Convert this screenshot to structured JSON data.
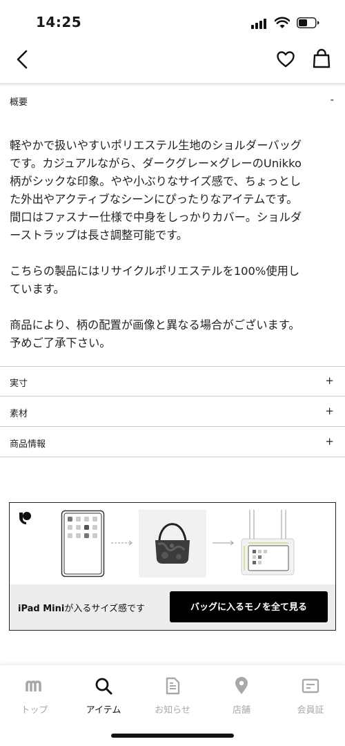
{
  "status_bar": {
    "time": "14:25",
    "signal_icon": "signal-bars-icon",
    "wifi_icon": "wifi-icon",
    "battery_icon": "battery-icon"
  },
  "nav": {
    "back_icon": "chevron-left-icon",
    "favorite_icon": "heart-icon",
    "cart_icon": "shopping-bag-icon"
  },
  "accordion": {
    "summary": {
      "label": "概要",
      "toggle": "-",
      "paragraphs": [
        "軽やかで扱いやすいポリエステル生地のショルダーバッグ\nです。カジュアルながら、ダークグレー×グレーのUnikko\n柄がシックな印象。やや小ぶりなサイズ感で、ちょっとし\nた外出やアクティブなシーンにぴったりなアイテムです。\n間口はファスナー仕様で中身をしっかりカバー。ショルダ\nーストラップは長さ調整可能です。",
        "こちらの製品にはリサイクルポリエステルを100%使用し\nています。",
        "商品により、柄の配置が画像と異なる場合がございます。\n予めご了承下さい。"
      ]
    },
    "sections": [
      {
        "label": "実寸",
        "toggle": "+"
      },
      {
        "label": "素材",
        "toggle": "+"
      },
      {
        "label": "商品情報",
        "toggle": "+"
      }
    ]
  },
  "size_banner": {
    "logo_icon": "unikko-logo-icon",
    "caption_bold": "iPad Mini",
    "caption_rest": "が入るサイズ感です",
    "button_label": "バッグに入るモノを全て見る"
  },
  "tab_bar": {
    "items": [
      {
        "label": "トップ",
        "icon": "marimekko-m-icon",
        "active": false
      },
      {
        "label": "アイテム",
        "icon": "search-icon",
        "active": true
      },
      {
        "label": "お知らせ",
        "icon": "document-icon",
        "active": false
      },
      {
        "label": "店舗",
        "icon": "location-pin-icon",
        "active": false
      },
      {
        "label": "会員証",
        "icon": "member-card-icon",
        "active": false
      }
    ]
  },
  "colors": {
    "text": "#1a1a1a",
    "divider": "#c9c9c9",
    "inactive_tab": "#a8a8a8",
    "button_bg": "#000000"
  }
}
